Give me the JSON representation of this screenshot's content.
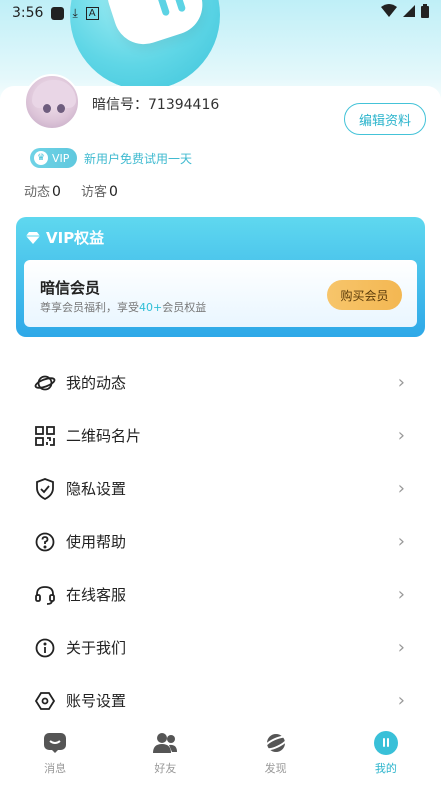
{
  "status_bar": {
    "time": "3:56"
  },
  "profile": {
    "id_label": "暗信号：",
    "id_value": "71394416",
    "edit_label": "编辑资料",
    "vip_tag": "VIP",
    "vip_trial_text": "新用户免费试用一天",
    "stats": [
      {
        "label": "动态",
        "value": "0"
      },
      {
        "label": "访客",
        "value": "0"
      }
    ]
  },
  "vip_card": {
    "title": "VIP权益",
    "member_title": "暗信会员",
    "subtitle_pre": "尊享会员福利，享受",
    "subtitle_highlight": "40+",
    "subtitle_post": "会员权益",
    "buy_label": "购买会员"
  },
  "menu": {
    "items": [
      {
        "label": "我的动态",
        "icon": "planet-icon"
      },
      {
        "label": "二维码名片",
        "icon": "qr-code-icon"
      },
      {
        "label": "隐私设置",
        "icon": "shield-check-icon"
      },
      {
        "label": "使用帮助",
        "icon": "help-circle-icon"
      },
      {
        "label": "在线客服",
        "icon": "headset-icon"
      },
      {
        "label": "关于我们",
        "icon": "info-icon"
      },
      {
        "label": "账号设置",
        "icon": "settings-hexagon-icon"
      }
    ]
  },
  "bottom_nav": {
    "items": [
      {
        "label": "消息",
        "icon": "message-icon",
        "active": false
      },
      {
        "label": "好友",
        "icon": "friends-icon",
        "active": false
      },
      {
        "label": "发现",
        "icon": "discover-planet-icon",
        "active": false
      },
      {
        "label": "我的",
        "icon": "me-icon",
        "active": true
      }
    ]
  },
  "colors": {
    "accent": "#2bb4cc",
    "vip_gradient_start": "#5fd8ef",
    "vip_gradient_end": "#2ea8e8",
    "buy_button": "#f3b752"
  }
}
